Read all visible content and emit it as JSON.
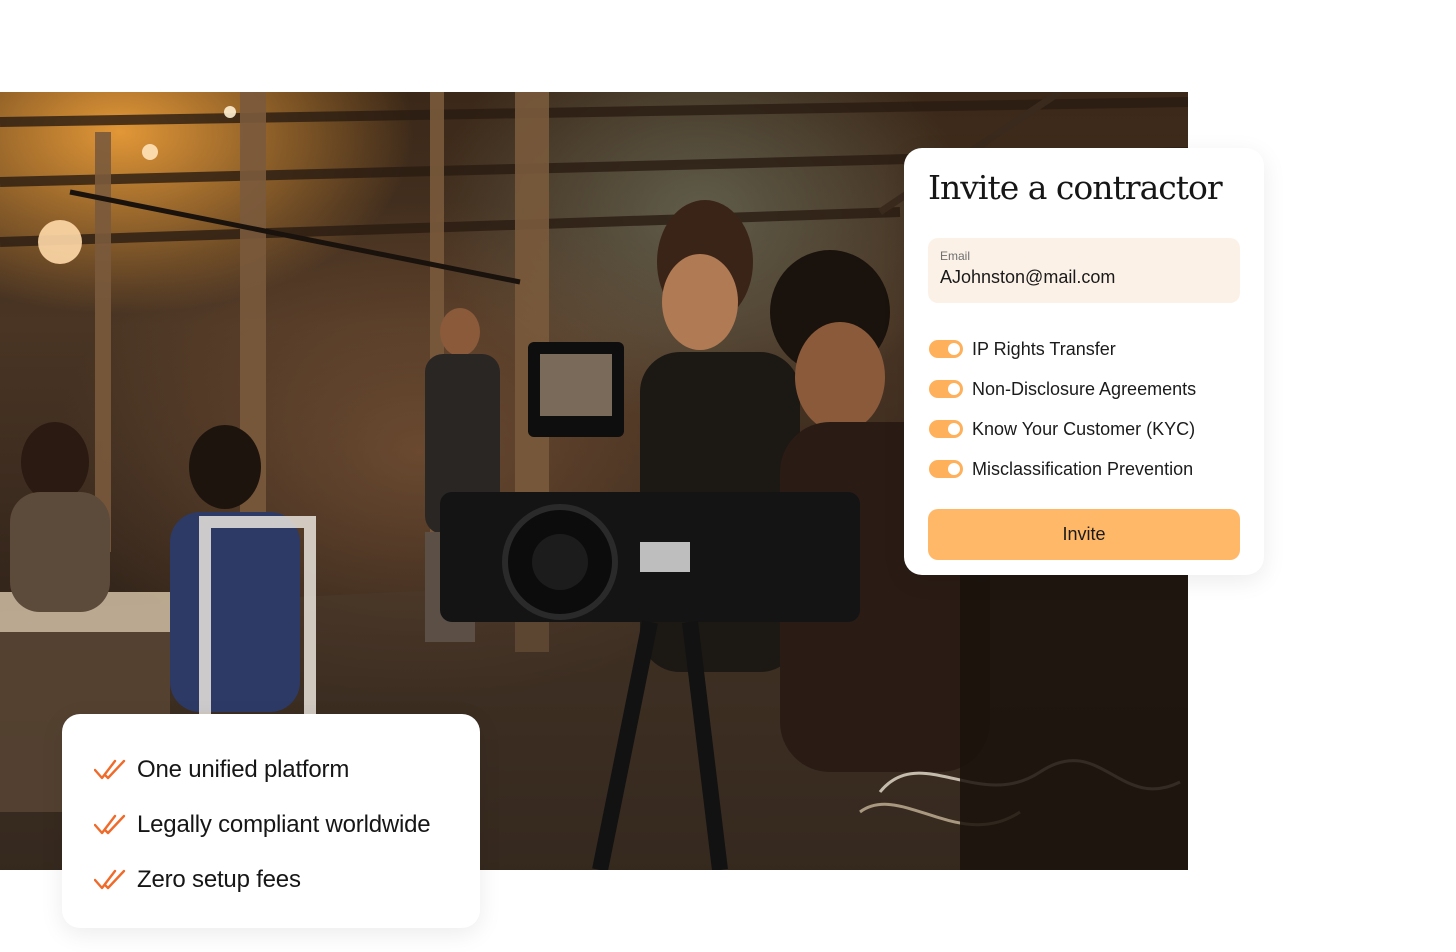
{
  "invite_card": {
    "title": "Invite a contractor",
    "email": {
      "label": "Email",
      "value": "AJohnston@mail.com"
    },
    "toggles": [
      {
        "label": "IP Rights Transfer",
        "on": true
      },
      {
        "label": "Non-Disclosure Agreements",
        "on": true
      },
      {
        "label": "Know Your Customer (KYC)",
        "on": true
      },
      {
        "label": "Misclassification Prevention",
        "on": true
      }
    ],
    "button_label": "Invite"
  },
  "features": [
    {
      "label": "One unified platform",
      "icon": "double-check-icon"
    },
    {
      "label": "Legally compliant worldwide",
      "icon": "double-check-icon"
    },
    {
      "label": "Zero setup fees",
      "icon": "double-check-icon"
    }
  ],
  "colors": {
    "accent": "#ffb868",
    "toggle_on": "#ffb05a",
    "field_bg": "#fbf1e7",
    "check": "#f06a2a"
  }
}
